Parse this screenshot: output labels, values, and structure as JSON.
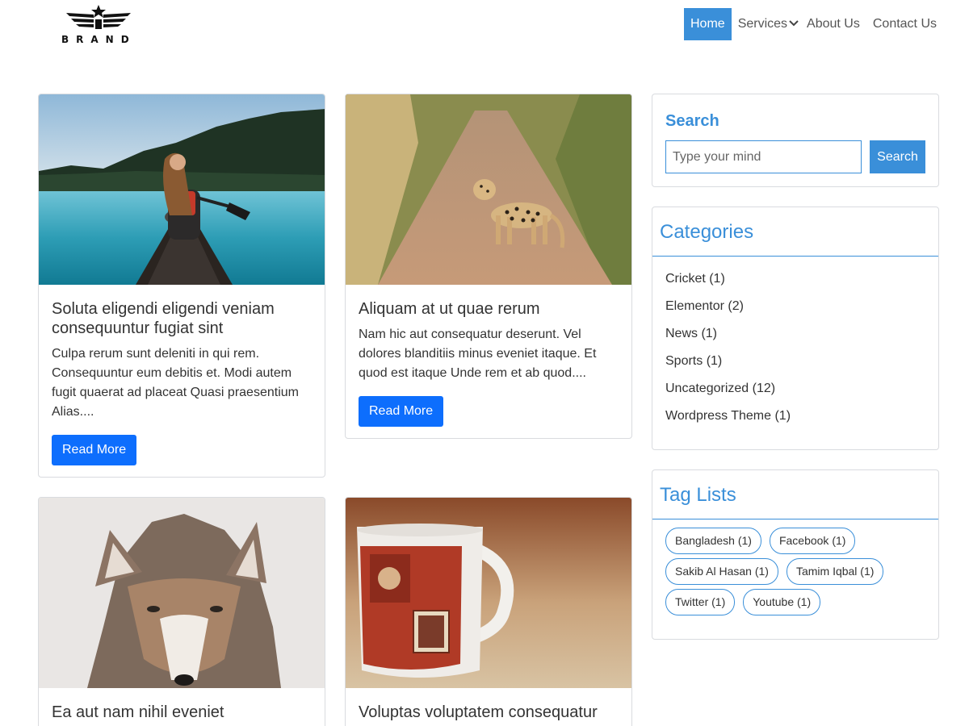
{
  "header": {
    "brand": "BRAND",
    "nav": [
      {
        "label": "Home"
      },
      {
        "label": "Services"
      },
      {
        "label": "About Us"
      },
      {
        "label": "Contact Us"
      }
    ]
  },
  "posts": [
    {
      "title": "Soluta eligendi eligendi veniam consequuntur fugiat sint",
      "excerpt": "Culpa rerum sunt deleniti in qui rem. Consequuntur eum debitis et. Modi autem fugit quaerat ad placeat Quasi praesentium Alias....",
      "button": "Read More"
    },
    {
      "title": "Aliquam at ut quae rerum",
      "excerpt": "Nam hic aut consequatur deserunt. Vel dolores blanditiis minus eveniet itaque. Et quod est itaque Unde rem et ab quod....",
      "button": "Read More"
    },
    {
      "title": "Ea aut nam nihil eveniet"
    },
    {
      "title": "Voluptas voluptatem consequatur"
    }
  ],
  "sidebar": {
    "search": {
      "title": "Search",
      "placeholder": "Type your mind",
      "button": "Search"
    },
    "categories": {
      "title": "Categories",
      "items": [
        "Cricket (1)",
        "Elementor (2)",
        "News (1)",
        "Sports (1)",
        "Uncategorized (12)",
        "Wordpress Theme (1)"
      ]
    },
    "tags": {
      "title": "Tag Lists",
      "items": [
        "Bangladesh (1)",
        "Facebook (1)",
        "Sakib Al Hasan (1)",
        "Tamim Iqbal (1)",
        "Twitter (1)",
        "Youtube (1)"
      ]
    }
  },
  "colors": {
    "accent": "#3a8fd9",
    "primary_button": "#0d6efd"
  }
}
